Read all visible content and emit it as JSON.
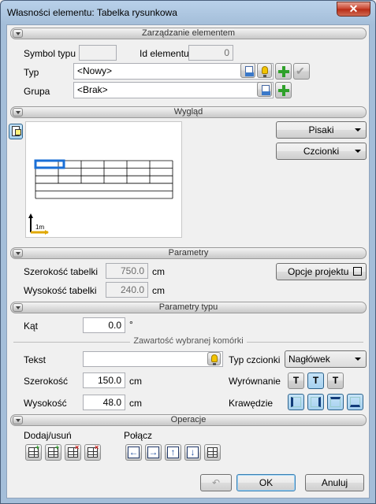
{
  "window": {
    "title": "Własności elementu: Tabelka rysunkowa",
    "close_glyph": "✕"
  },
  "sections": {
    "element": "Zarządzanie elementem",
    "appearance": "Wygląd",
    "parameters": "Parametry",
    "type_params": "Parametry typu",
    "operations": "Operacje"
  },
  "element": {
    "symbol_label": "Symbol typu",
    "symbol_value": "",
    "id_label": "Id elementu",
    "id_value": "0",
    "type_label": "Typ",
    "type_value": "<Nowy>",
    "group_label": "Grupa",
    "group_value": "<Brak>"
  },
  "appearance": {
    "pens_button": "Pisaki",
    "fonts_button": "Czcionki",
    "scale_label": "1m",
    "table_rows": 5,
    "table_cols": 6
  },
  "parameters": {
    "width_label": "Szerokość tabelki",
    "width_value": "750.0",
    "width_unit": "cm",
    "height_label": "Wysokość tabelki",
    "height_value": "240.0",
    "height_unit": "cm",
    "project_options_button": "Opcje projektu"
  },
  "type_params": {
    "angle_label": "Kąt",
    "angle_value": "0.0",
    "angle_unit": "°",
    "cell_content_header": "Zawartość wybranej komórki",
    "text_label": "Tekst",
    "text_value": "",
    "font_type_label": "Typ czcionki",
    "font_type_value": "Nagłówek",
    "cell_width_label": "Szerokość",
    "cell_width_value": "150.0",
    "cell_width_unit": "cm",
    "cell_height_label": "Wysokość",
    "cell_height_value": "48.0",
    "cell_height_unit": "cm",
    "alignment_label": "Wyrównanie",
    "borders_label": "Krawędzie",
    "align_glyph": "T"
  },
  "operations": {
    "add_remove_label": "Dodaj/usuń",
    "merge_label": "Połącz",
    "arrows": [
      "←",
      "→",
      "↑",
      "↓"
    ]
  },
  "footer": {
    "undo_glyph": "↶",
    "ok_button": "OK",
    "cancel_button": "Anuluj"
  },
  "colors": {
    "accent": "#3c7fb1",
    "add_green": "#2fa12a",
    "selection_blue": "#1a6fd6",
    "close_red": "#c7412b"
  }
}
